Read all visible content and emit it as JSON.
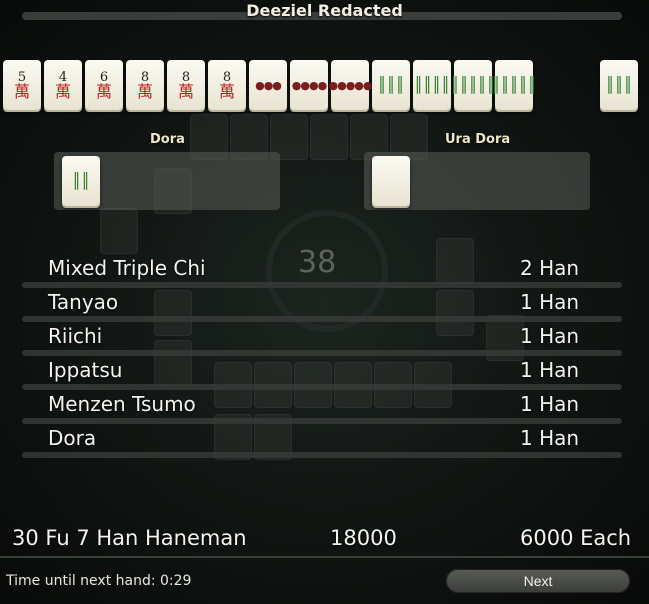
{
  "title": "Deeziel Redacted",
  "hand_tiles": [
    {
      "suit": "man",
      "top": "5",
      "bottom": "萬"
    },
    {
      "suit": "man",
      "top": "4",
      "bottom": "萬"
    },
    {
      "suit": "man",
      "top": "6",
      "bottom": "萬"
    },
    {
      "suit": "man",
      "top": "8",
      "bottom": "萬"
    },
    {
      "suit": "man",
      "top": "8",
      "bottom": "萬"
    },
    {
      "suit": "man",
      "top": "8",
      "bottom": "萬"
    },
    {
      "suit": "pin",
      "glyph": "●●●"
    },
    {
      "suit": "pin",
      "glyph": "●●●●"
    },
    {
      "suit": "pin",
      "glyph": "●●●●●"
    },
    {
      "suit": "sou",
      "glyph": "║║║"
    },
    {
      "suit": "sou",
      "glyph": "║║║║"
    },
    {
      "suit": "sou",
      "glyph": "║║║║║"
    },
    {
      "suit": "sou",
      "glyph": "║║║║║"
    }
  ],
  "winning_tile": {
    "suit": "sou",
    "glyph": "║║║"
  },
  "dora": {
    "label": "Dora",
    "tiles": [
      {
        "suit": "sou",
        "glyph": "║║"
      }
    ]
  },
  "ura_dora": {
    "label": "Ura Dora",
    "tiles": [
      {
        "suit": "blank",
        "glyph": ""
      }
    ]
  },
  "board": {
    "wall_count": "38"
  },
  "yaku": [
    {
      "name": "Mixed Triple Chi",
      "han": "2 Han"
    },
    {
      "name": "Tanyao",
      "han": "1 Han"
    },
    {
      "name": "Riichi",
      "han": "1 Han"
    },
    {
      "name": "Ippatsu",
      "han": "1 Han"
    },
    {
      "name": "Menzen Tsumo",
      "han": "1 Han"
    },
    {
      "name": "Dora",
      "han": "1 Han"
    }
  ],
  "summary": {
    "hand_value": "30 Fu 7 Han Haneman",
    "points": "18000",
    "payment": "6000 Each"
  },
  "footer": {
    "timer": "Time until next hand: 0:29",
    "next_label": "Next"
  }
}
